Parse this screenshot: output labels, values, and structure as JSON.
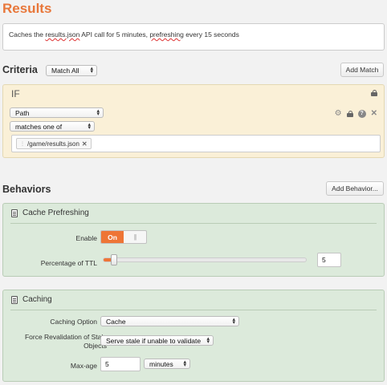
{
  "page": {
    "title": "Results",
    "description": {
      "part1": "Caches the ",
      "part2": "results.json",
      "part3": " API call for 5 minutes, ",
      "part4": "prefreshing",
      "part5": " every 15 seconds"
    }
  },
  "criteria": {
    "heading": "Criteria",
    "match_select": "Match All",
    "add_match_label": "Add Match",
    "if_label": "IF",
    "field_select": "Path",
    "operator_select": "matches one of",
    "values": [
      {
        "text": "/game/results.json"
      }
    ],
    "icons": [
      "gear-icon",
      "lock-icon",
      "help-icon",
      "close-icon"
    ]
  },
  "behaviors": {
    "heading": "Behaviors",
    "add_behavior_label": "Add Behavior...",
    "cache_prefreshing": {
      "title": "Cache Prefreshing",
      "enable_label": "Enable",
      "enable_value": "On",
      "ttl_label": "Percentage of TTL",
      "ttl_value": "5",
      "ttl_percent": 5
    },
    "caching": {
      "title": "Caching",
      "option_label": "Caching Option",
      "option_value": "Cache",
      "revalidation_label_line1": "Force Revalidation of Stale",
      "revalidation_label_line2": "Objects",
      "revalidation_value": "Serve stale if unable to validate",
      "maxage_label": "Max-age",
      "maxage_value": "5",
      "maxage_unit": "minutes"
    }
  },
  "colors": {
    "accent": "#e8773a",
    "if_panel": "#faf0d7",
    "behavior_panel": "#dceadb"
  }
}
